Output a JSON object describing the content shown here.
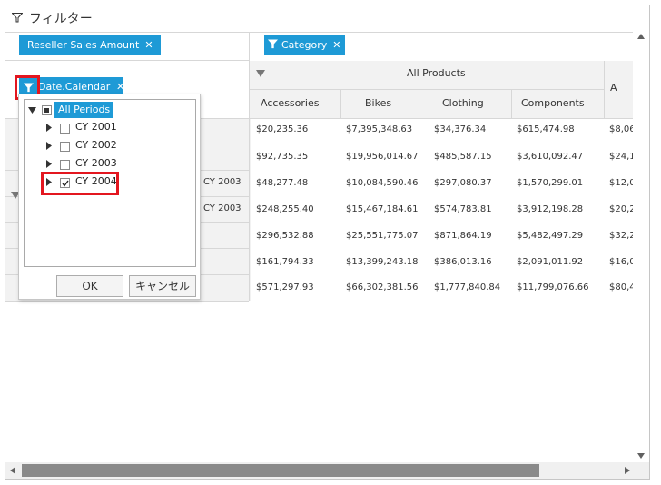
{
  "header": {
    "title": "フィルター"
  },
  "chips": {
    "measure": "Reseller Sales Amount",
    "column": "Category",
    "row": "Date.Calendar"
  },
  "columns": {
    "group": "All Products",
    "extra": "A",
    "items": [
      "Accessories",
      "Bikes",
      "Clothing",
      "Components"
    ]
  },
  "row_labels": [
    "CY 2003",
    "CY 2003"
  ],
  "rows": [
    [
      "$20,235.36",
      "$7,395,348.63",
      "$34,376.34",
      "$615,474.98",
      "$8,06"
    ],
    [
      "$92,735.35",
      "$19,956,014.67",
      "$485,587.15",
      "$3,610,092.47",
      "$24,1"
    ],
    [
      "$48,277.48",
      "$10,084,590.46",
      "$297,080.37",
      "$1,570,299.01",
      "$12,0"
    ],
    [
      "$248,255.40",
      "$15,467,184.61",
      "$574,783.81",
      "$3,912,198.28",
      "$20,2"
    ],
    [
      "$296,532.88",
      "$25,551,775.07",
      "$871,864.19",
      "$5,482,497.29",
      "$32,2"
    ],
    [
      "$161,794.33",
      "$13,399,243.18",
      "$386,013.16",
      "$2,091,011.92",
      "$16,0"
    ],
    [
      "$571,297.93",
      "$66,302,381.56",
      "$1,777,840.84",
      "$11,799,076.66",
      "$80,4"
    ]
  ],
  "popup": {
    "root": "All Periods",
    "items": [
      {
        "label": "CY 2001",
        "checked": false
      },
      {
        "label": "CY 2002",
        "checked": false
      },
      {
        "label": "CY 2003",
        "checked": false
      },
      {
        "label": "CY 2004",
        "checked": true
      }
    ],
    "ok_label": "OK",
    "cancel_label": "キャンセル"
  },
  "colors": {
    "accent": "#1e9ad6",
    "highlight": "#e3161f",
    "header_bg": "#f2f2f2",
    "scroll_thumb": "#8a8a8a"
  },
  "scrollbar": {
    "horizontal_thumb_fraction": 0.85
  }
}
